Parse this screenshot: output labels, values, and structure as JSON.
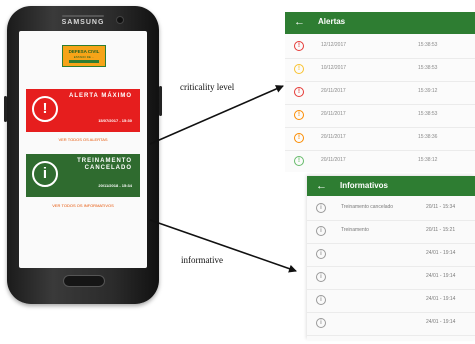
{
  "phone": {
    "brand": "SAMSUNG",
    "logo_title": "DEFESA CIVIL",
    "logo_subtitle": "ESTADO DE ...",
    "alert_card": {
      "icon": "!",
      "title": "ALERTA MÁXIMO",
      "date": "15/07/2017 - 15:30",
      "color": "#e61e1e"
    },
    "alert_link": "VER TODOS OS ALERTAS",
    "info_card": {
      "icon": "i",
      "title": "TREINAMENTO CANCELADO",
      "date": "20/11/2018 - 15:34",
      "color": "#2f6b2f"
    },
    "info_link": "VER TODOS OS INFORMATIVOS"
  },
  "annotations": {
    "top": "criticality level",
    "bottom": "informative"
  },
  "alertas": {
    "title": "Alertas",
    "rows": [
      {
        "date": "12/12/2017",
        "time": "15:38:53",
        "level": "red",
        "icon": "!"
      },
      {
        "date": "10/12/2017",
        "time": "15:38:53",
        "level": "yellow",
        "icon": "!"
      },
      {
        "date": "20/11/2017",
        "time": "15:39:12",
        "level": "red",
        "icon": "!"
      },
      {
        "date": "20/11/2017",
        "time": "15:38:53",
        "level": "orange",
        "icon": "!"
      },
      {
        "date": "20/11/2017",
        "time": "15:38:36",
        "level": "orange",
        "icon": "!"
      },
      {
        "date": "20/11/2017",
        "time": "15:38:12",
        "level": "green",
        "icon": "!"
      }
    ]
  },
  "informativos": {
    "title": "Informativos",
    "rows": [
      {
        "name": "Treinamento cancelado",
        "time": "20/11 - 15:34"
      },
      {
        "name": "Treinamento",
        "time": "20/11 - 15:21"
      },
      {
        "name": "",
        "time": "24/01 - 19:14"
      },
      {
        "name": "",
        "time": "24/01 - 19:14"
      },
      {
        "name": "",
        "time": "24/01 - 19:14"
      },
      {
        "name": "",
        "time": "24/01 - 19:14"
      }
    ]
  },
  "colors": {
    "green": "#2e7d32",
    "red": "#e53935",
    "yellow": "#f9c22e",
    "orange": "#fb8c00",
    "light_green": "#66bb6a"
  }
}
